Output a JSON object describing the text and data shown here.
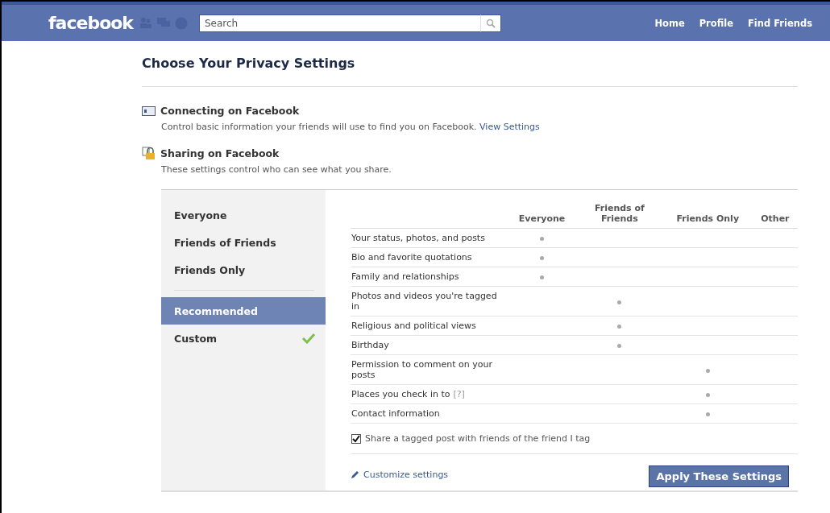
{
  "topbar": {
    "logo": "facebook",
    "search": {
      "placeholder": "Search"
    },
    "nav": [
      "Home",
      "Profile",
      "Find Friends"
    ]
  },
  "title": "Choose Your Privacy Settings",
  "sections": [
    {
      "kind": "connect",
      "heading": "Connecting on Facebook",
      "text": "Control basic information your friends will use to find you on Facebook.",
      "link": "View Settings"
    },
    {
      "kind": "lock",
      "heading": "Sharing on Facebook",
      "text": "These settings control who can see what you share."
    }
  ],
  "presets": [
    {
      "label": "Everyone",
      "selected": false,
      "checked": false
    },
    {
      "label": "Friends of Friends",
      "selected": false,
      "checked": false
    },
    {
      "label": "Friends Only",
      "selected": false,
      "checked": false
    }
  ],
  "modes": [
    {
      "label": "Recommended",
      "selected": true,
      "checked": false
    },
    {
      "label": "Custom",
      "selected": false,
      "checked": true
    }
  ],
  "table": {
    "columns": [
      "Everyone",
      "Friends of Friends",
      "Friends Only",
      "Other"
    ],
    "rows": [
      {
        "label": "Your status, photos, and posts",
        "cells": [
          {
            "selected": true
          },
          {
            "selected": false
          },
          {
            "selected": false
          },
          {
            "selected": false
          }
        ]
      },
      {
        "label": "Bio and favorite quotations",
        "cells": [
          {
            "selected": true
          },
          {
            "selected": false
          },
          {
            "selected": false
          },
          {
            "selected": false
          }
        ]
      },
      {
        "label": "Family and relationships",
        "cells": [
          {
            "selected": true
          },
          {
            "selected": false
          },
          {
            "selected": false
          },
          {
            "selected": false
          }
        ]
      },
      {
        "label": "Photos and videos you're tagged in",
        "cells": [
          {
            "selected": false
          },
          {
            "selected": true
          },
          {
            "selected": false
          },
          {
            "selected": false
          }
        ]
      },
      {
        "label": "Religious and political views",
        "cells": [
          {
            "selected": false
          },
          {
            "selected": true
          },
          {
            "selected": false
          },
          {
            "selected": false
          }
        ]
      },
      {
        "label": "Birthday",
        "cells": [
          {
            "selected": false
          },
          {
            "selected": true
          },
          {
            "selected": false
          },
          {
            "selected": false
          }
        ]
      },
      {
        "label": "Permission to comment on your posts",
        "cells": [
          {
            "selected": false
          },
          {
            "selected": false
          },
          {
            "selected": true
          },
          {
            "selected": false
          }
        ]
      },
      {
        "label": "Places you check in to",
        "help": "[?]",
        "cells": [
          {
            "selected": false
          },
          {
            "selected": false
          },
          {
            "selected": true
          },
          {
            "selected": false
          }
        ]
      },
      {
        "label": "Contact information",
        "cells": [
          {
            "selected": false
          },
          {
            "selected": false
          },
          {
            "selected": true
          },
          {
            "selected": false
          }
        ]
      }
    ]
  },
  "share_tagged": {
    "label": "Share a tagged post with friends of the friend I tag",
    "checked": true
  },
  "customize_link": "Customize settings",
  "apply_button": "Apply These Settings"
}
